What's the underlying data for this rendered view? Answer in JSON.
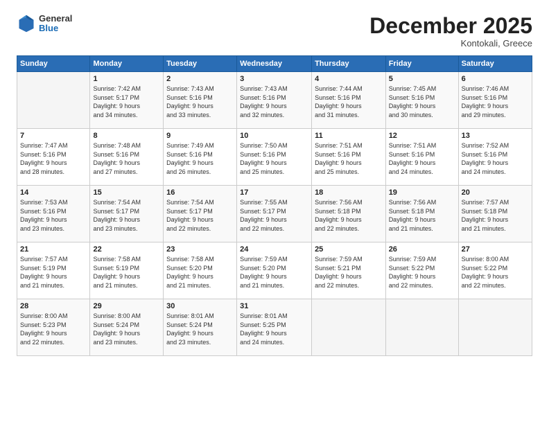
{
  "header": {
    "logo": {
      "line1": "General",
      "line2": "Blue"
    },
    "title": "December 2025",
    "subtitle": "Kontokali, Greece"
  },
  "weekdays": [
    "Sunday",
    "Monday",
    "Tuesday",
    "Wednesday",
    "Thursday",
    "Friday",
    "Saturday"
  ],
  "weeks": [
    [
      {
        "day": "",
        "info": ""
      },
      {
        "day": "1",
        "info": "Sunrise: 7:42 AM\nSunset: 5:17 PM\nDaylight: 9 hours\nand 34 minutes."
      },
      {
        "day": "2",
        "info": "Sunrise: 7:43 AM\nSunset: 5:16 PM\nDaylight: 9 hours\nand 33 minutes."
      },
      {
        "day": "3",
        "info": "Sunrise: 7:43 AM\nSunset: 5:16 PM\nDaylight: 9 hours\nand 32 minutes."
      },
      {
        "day": "4",
        "info": "Sunrise: 7:44 AM\nSunset: 5:16 PM\nDaylight: 9 hours\nand 31 minutes."
      },
      {
        "day": "5",
        "info": "Sunrise: 7:45 AM\nSunset: 5:16 PM\nDaylight: 9 hours\nand 30 minutes."
      },
      {
        "day": "6",
        "info": "Sunrise: 7:46 AM\nSunset: 5:16 PM\nDaylight: 9 hours\nand 29 minutes."
      }
    ],
    [
      {
        "day": "7",
        "info": "Sunrise: 7:47 AM\nSunset: 5:16 PM\nDaylight: 9 hours\nand 28 minutes."
      },
      {
        "day": "8",
        "info": "Sunrise: 7:48 AM\nSunset: 5:16 PM\nDaylight: 9 hours\nand 27 minutes."
      },
      {
        "day": "9",
        "info": "Sunrise: 7:49 AM\nSunset: 5:16 PM\nDaylight: 9 hours\nand 26 minutes."
      },
      {
        "day": "10",
        "info": "Sunrise: 7:50 AM\nSunset: 5:16 PM\nDaylight: 9 hours\nand 25 minutes."
      },
      {
        "day": "11",
        "info": "Sunrise: 7:51 AM\nSunset: 5:16 PM\nDaylight: 9 hours\nand 25 minutes."
      },
      {
        "day": "12",
        "info": "Sunrise: 7:51 AM\nSunset: 5:16 PM\nDaylight: 9 hours\nand 24 minutes."
      },
      {
        "day": "13",
        "info": "Sunrise: 7:52 AM\nSunset: 5:16 PM\nDaylight: 9 hours\nand 24 minutes."
      }
    ],
    [
      {
        "day": "14",
        "info": "Sunrise: 7:53 AM\nSunset: 5:16 PM\nDaylight: 9 hours\nand 23 minutes."
      },
      {
        "day": "15",
        "info": "Sunrise: 7:54 AM\nSunset: 5:17 PM\nDaylight: 9 hours\nand 23 minutes."
      },
      {
        "day": "16",
        "info": "Sunrise: 7:54 AM\nSunset: 5:17 PM\nDaylight: 9 hours\nand 22 minutes."
      },
      {
        "day": "17",
        "info": "Sunrise: 7:55 AM\nSunset: 5:17 PM\nDaylight: 9 hours\nand 22 minutes."
      },
      {
        "day": "18",
        "info": "Sunrise: 7:56 AM\nSunset: 5:18 PM\nDaylight: 9 hours\nand 22 minutes."
      },
      {
        "day": "19",
        "info": "Sunrise: 7:56 AM\nSunset: 5:18 PM\nDaylight: 9 hours\nand 21 minutes."
      },
      {
        "day": "20",
        "info": "Sunrise: 7:57 AM\nSunset: 5:18 PM\nDaylight: 9 hours\nand 21 minutes."
      }
    ],
    [
      {
        "day": "21",
        "info": "Sunrise: 7:57 AM\nSunset: 5:19 PM\nDaylight: 9 hours\nand 21 minutes."
      },
      {
        "day": "22",
        "info": "Sunrise: 7:58 AM\nSunset: 5:19 PM\nDaylight: 9 hours\nand 21 minutes."
      },
      {
        "day": "23",
        "info": "Sunrise: 7:58 AM\nSunset: 5:20 PM\nDaylight: 9 hours\nand 21 minutes."
      },
      {
        "day": "24",
        "info": "Sunrise: 7:59 AM\nSunset: 5:20 PM\nDaylight: 9 hours\nand 21 minutes."
      },
      {
        "day": "25",
        "info": "Sunrise: 7:59 AM\nSunset: 5:21 PM\nDaylight: 9 hours\nand 22 minutes."
      },
      {
        "day": "26",
        "info": "Sunrise: 7:59 AM\nSunset: 5:22 PM\nDaylight: 9 hours\nand 22 minutes."
      },
      {
        "day": "27",
        "info": "Sunrise: 8:00 AM\nSunset: 5:22 PM\nDaylight: 9 hours\nand 22 minutes."
      }
    ],
    [
      {
        "day": "28",
        "info": "Sunrise: 8:00 AM\nSunset: 5:23 PM\nDaylight: 9 hours\nand 22 minutes."
      },
      {
        "day": "29",
        "info": "Sunrise: 8:00 AM\nSunset: 5:24 PM\nDaylight: 9 hours\nand 23 minutes."
      },
      {
        "day": "30",
        "info": "Sunrise: 8:01 AM\nSunset: 5:24 PM\nDaylight: 9 hours\nand 23 minutes."
      },
      {
        "day": "31",
        "info": "Sunrise: 8:01 AM\nSunset: 5:25 PM\nDaylight: 9 hours\nand 24 minutes."
      },
      {
        "day": "",
        "info": ""
      },
      {
        "day": "",
        "info": ""
      },
      {
        "day": "",
        "info": ""
      }
    ]
  ]
}
